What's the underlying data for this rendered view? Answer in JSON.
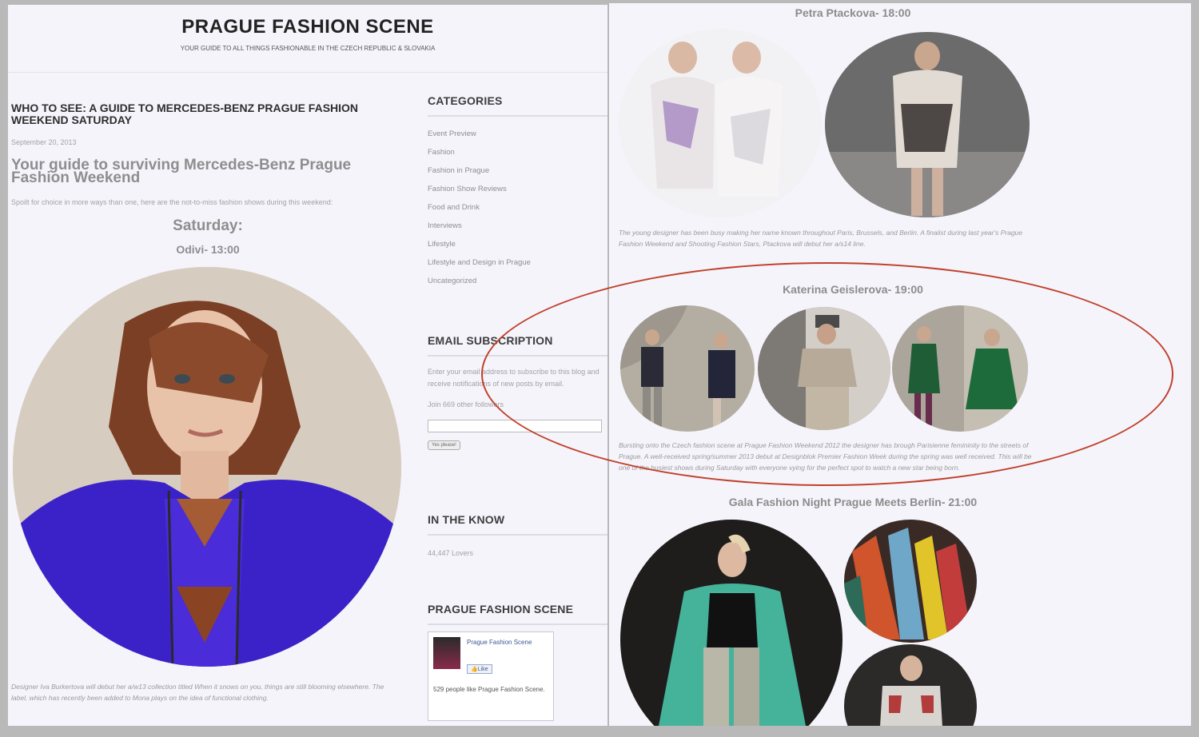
{
  "site": {
    "title": "PRAGUE FASHION SCENE",
    "tagline": "YOUR GUIDE TO ALL THINGS FASHIONABLE IN THE CZECH REPUBLIC & SLOVAKIA"
  },
  "post": {
    "headline": "WHO TO SEE: A GUIDE TO MERCEDES-BENZ PRAGUE FASHION WEEKEND SATURDAY",
    "date": "September 20, 2013",
    "subtitle": "Your guide to surviving Mercedes-Benz Prague Fashion Weekend",
    "intro": "Spoilt for choice in more ways than one, here are the not-to-miss fashion shows during this weekend:",
    "day_heading": "Saturday:",
    "show1": "Odivi- 13:00",
    "caption1": "Designer Iva Burkertova will debut her a/w13 collection titled When it snows on you, things are still blooming elsewhere. The label, which has recently been added to Mona plays on the idea of functional clothing."
  },
  "sidebar": {
    "categories_heading": "CATEGORIES",
    "categories": [
      "Event Preview",
      "Fashion",
      "Fashion in Prague",
      "Fashion Show Reviews",
      "Food and Drink",
      "Interviews",
      "Lifestyle",
      "Lifestyle and Design in Prague",
      "Uncategorized"
    ],
    "email_heading": "EMAIL SUBSCRIPTION",
    "email_text": "Enter your email address to subscribe to this blog and receive notifications of new posts by email.",
    "followers": "Join 669 other followers",
    "email_placeholder": "",
    "subscribe_label": "Yes please!",
    "inknow_heading": "IN THE KNOW",
    "lovers": "44,447 Lovers",
    "fb_heading": "PRAGUE FASHION SCENE",
    "fb_page_name": "Prague Fashion Scene",
    "fb_like": "Like",
    "fb_count_text": "529 people like Prague Fashion Scene."
  },
  "right": {
    "show2": "Petra Ptackova- 18:00",
    "caption2": "The young designer has been busy making her name known throughout Paris, Brussels, and Berlin. A finalist during last year's Prague Fashion Weekend and Shooting Fashion Stars, Ptackova will debut her a/s14 line.",
    "show3": "Katerina Geislerova- 19:00",
    "caption3": "Bursting onto the Czech fashion scene at Prague Fashion Weekend 2012 the designer has brough Parisienne femininity to the streets of Prague. A well-received spring/summer 2013 debut at Designblok Premier Fashion Week during the spring was well received. This will be one of the busiest shows during Saturday with everyone vying for the perfect spot to watch a new star being born.",
    "show4": "Gala Fashion Night Prague Meets Berlin- 21:00"
  },
  "colors": {
    "accent_outline": "#c0402a",
    "coat_blue": "#3a22c8"
  }
}
